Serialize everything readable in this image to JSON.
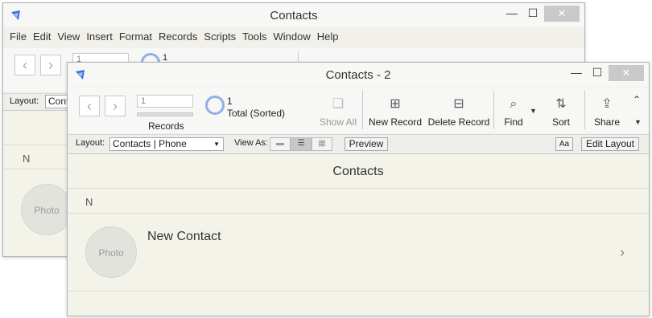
{
  "back_window": {
    "title": "Contacts",
    "menu": [
      "File",
      "Edit",
      "View",
      "Insert",
      "Format",
      "Records",
      "Scripts",
      "Tools",
      "Window",
      "Help"
    ],
    "record_field_value": "1",
    "found_count": "1",
    "layout_label": "Layout:",
    "layout_value": "Conta",
    "section_letter": "N",
    "photo_label": "Photo"
  },
  "front_window": {
    "title": "Contacts - 2",
    "record_field_value": "1",
    "records_label": "Records",
    "found_count": "1",
    "found_status": "Total (Sorted)",
    "toolbar": {
      "show_all": "Show All",
      "new_record": "New Record",
      "delete_record": "Delete Record",
      "find": "Find",
      "sort": "Sort",
      "share": "Share"
    },
    "layout_label": "Layout:",
    "layout_value": "Contacts | Phone",
    "view_as_label": "View As:",
    "preview_button": "Preview",
    "text_format_button": "Aa",
    "edit_layout_button": "Edit Layout",
    "header_title": "Contacts",
    "section_letter": "N",
    "contact_name": "New Contact",
    "photo_label": "Photo"
  },
  "icons": {
    "minimize": "minimize-icon",
    "maximize": "maximize-icon",
    "close": "close-icon",
    "back": "chevron-left-icon",
    "forward": "chevron-right-icon",
    "find": "magnifier-icon",
    "sort": "sort-icon",
    "share": "share-icon"
  }
}
